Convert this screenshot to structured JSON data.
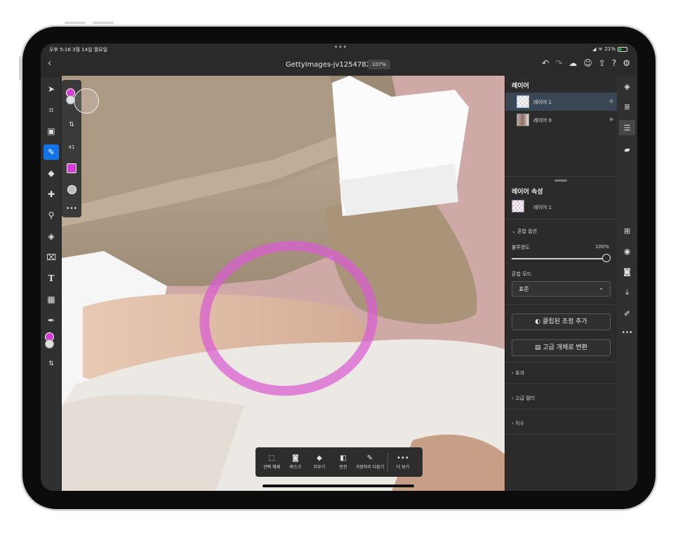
{
  "status": {
    "time": "오후 5:16  3월 14일 월요일",
    "battery": "21%"
  },
  "titlebar": {
    "title": "GettyImages-jv12547822 *",
    "zoom": "107%"
  },
  "colors": {
    "foreground": "#d63ad8",
    "background": "#e2e2e2",
    "brush_ring": "#d95bd2",
    "accent": "#1473e6"
  },
  "subtoolbar": {
    "brush_size": "41"
  },
  "layers": {
    "heading": "레이어",
    "items": [
      {
        "name": "레이어 1",
        "selected": true
      },
      {
        "name": "레이어 0",
        "selected": false
      }
    ]
  },
  "properties": {
    "heading": "레이어 속성",
    "layer_name": "레이어 1",
    "blend_options": "혼합 옵션",
    "opacity_label": "불투명도",
    "opacity_value": "100%",
    "opacity": 1.0,
    "blend_mode_label": "혼합 모드",
    "blend_mode_value": "표준",
    "add_clipped_adjustment": "클립된 조정 추가",
    "convert_smart_object": "고급 개체로 변환",
    "effects": "효과",
    "smart_filters": "고급 필터",
    "dimensions": "치수"
  },
  "tasks": [
    {
      "label": "선택 해제",
      "icon": "deselect-icon"
    },
    {
      "label": "마스크",
      "icon": "mask-icon"
    },
    {
      "label": "지우기",
      "icon": "eraser-icon"
    },
    {
      "label": "반전",
      "icon": "invert-icon"
    },
    {
      "label": "가장자리 다듬기",
      "icon": "refine-edge-icon"
    },
    {
      "label": "더 보기",
      "icon": "more-icon"
    }
  ]
}
